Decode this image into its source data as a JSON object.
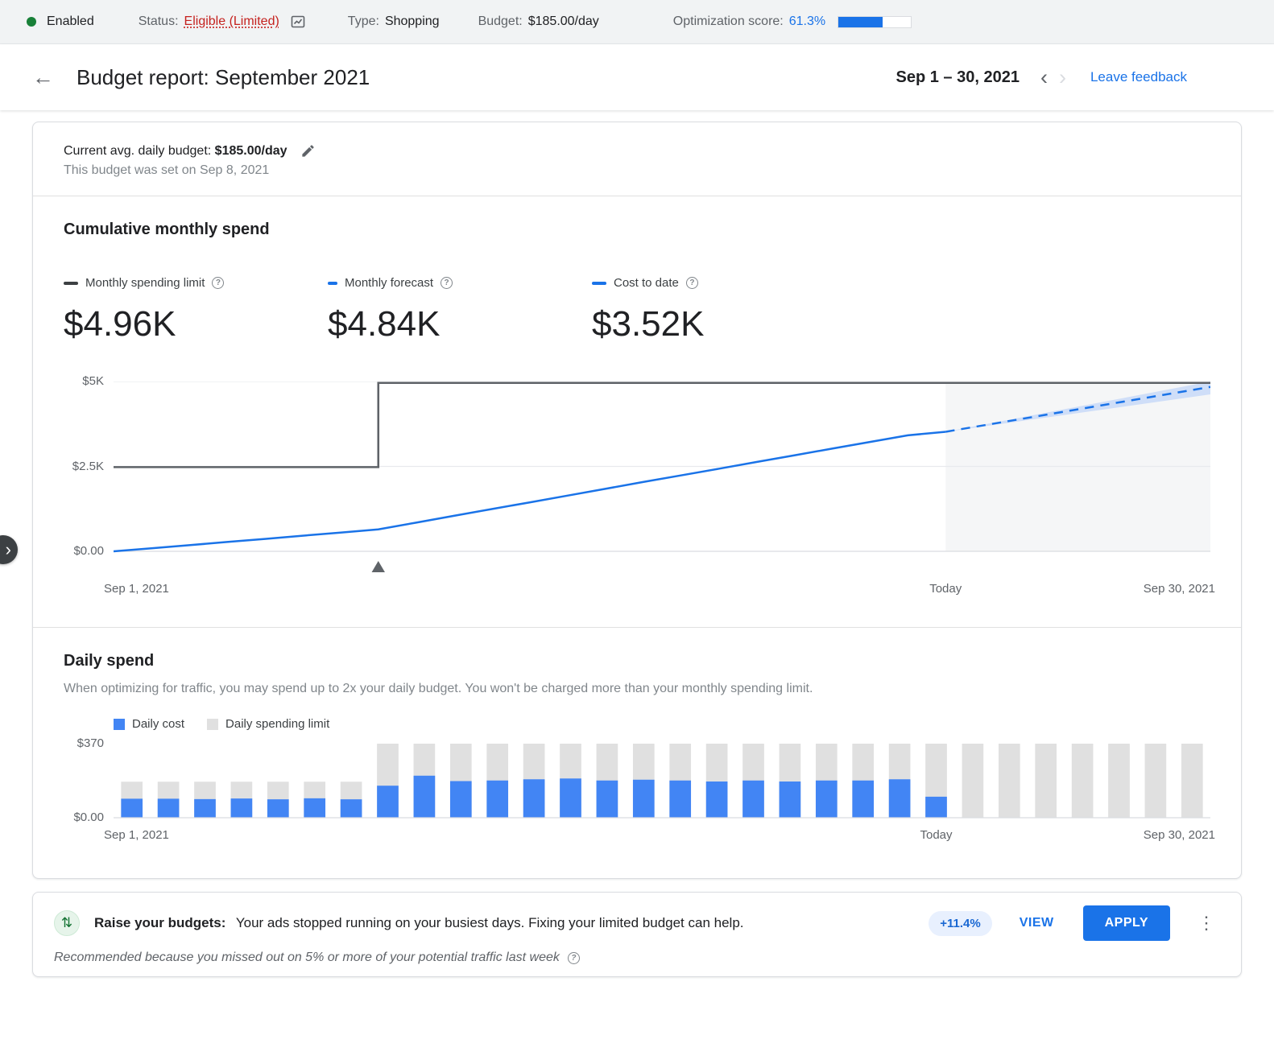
{
  "topbar": {
    "enabled_label": "Enabled",
    "status_label": "Status:",
    "status_value": "Eligible (Limited)",
    "type_label": "Type:",
    "type_value": "Shopping",
    "budget_label": "Budget:",
    "budget_value": "$185.00/day",
    "optimization_label": "Optimization score:",
    "optimization_value": "61.3%",
    "optimization_percent": 61.3
  },
  "header": {
    "title": "Budget report: September 2021",
    "date_range": "Sep 1 – 30, 2021",
    "prev_chevron": "‹",
    "next_chevron": "›",
    "feedback_link": "Leave feedback"
  },
  "budget_summary": {
    "label": "Current avg. daily budget:",
    "value": "$185.00/day",
    "note": "This budget was set on Sep 8, 2021"
  },
  "cumulative_section": {
    "title": "Cumulative monthly spend",
    "stats": [
      {
        "label": "Monthly spending limit",
        "value": "$4.96K",
        "color": "#3c4043"
      },
      {
        "label": "Monthly forecast",
        "value": "$4.84K",
        "color": "#1a73e8"
      },
      {
        "label": "Cost to date",
        "value": "$3.52K",
        "color": "#1a73e8"
      }
    ]
  },
  "daily_section": {
    "title": "Daily spend",
    "subtitle": "When optimizing for traffic, you may spend up to 2x your daily budget. You won't be charged more than your monthly spending limit.",
    "legend": [
      {
        "label": "Daily cost",
        "color": "#4285f4"
      },
      {
        "label": "Daily spending limit",
        "color": "#e0e0e0"
      }
    ]
  },
  "recommendation": {
    "title": "Raise your budgets:",
    "description": "Your ads stopped running on your busiest days. Fixing your limited budget can help.",
    "badge": "+11.4%",
    "view_label": "VIEW",
    "apply_label": "APPLY",
    "footnote": "Recommended because you missed out on 5% or more of your potential traffic last week"
  },
  "chart_data": [
    {
      "type": "line",
      "title": "Cumulative monthly spend",
      "x_unit": "day of September 2021",
      "xlim": [
        1,
        30
      ],
      "ylim": [
        0,
        5000
      ],
      "today_day": 23,
      "budget_change_day": 8,
      "yticks": [
        {
          "value": 5000,
          "label": "$5K"
        },
        {
          "value": 2500,
          "label": "$2.5K"
        },
        {
          "value": 0,
          "label": "$0.00"
        }
      ],
      "xticks": [
        {
          "day": 1,
          "label": "Sep 1, 2021"
        },
        {
          "day": 23,
          "label": "Today"
        },
        {
          "day": 30,
          "label": "Sep 30, 2021"
        }
      ],
      "series": [
        {
          "name": "Monthly spending limit",
          "style": "step",
          "color": "#5f6368",
          "points": [
            [
              1,
              2480
            ],
            [
              8,
              2480
            ],
            [
              8,
              4960
            ],
            [
              30,
              4960
            ]
          ]
        },
        {
          "name": "Cost to date",
          "style": "solid",
          "color": "#1a73e8",
          "points": [
            [
              1,
              0
            ],
            [
              2,
              90
            ],
            [
              3,
              180
            ],
            [
              4,
              275
            ],
            [
              5,
              365
            ],
            [
              6,
              460
            ],
            [
              7,
              550
            ],
            [
              8,
              645
            ],
            [
              9,
              845
            ],
            [
              10,
              1045
            ],
            [
              11,
              1245
            ],
            [
              12,
              1440
            ],
            [
              13,
              1640
            ],
            [
              14,
              1840
            ],
            [
              15,
              2040
            ],
            [
              16,
              2235
            ],
            [
              17,
              2430
            ],
            [
              18,
              2630
            ],
            [
              19,
              2825
            ],
            [
              20,
              3025
            ],
            [
              21,
              3220
            ],
            [
              22,
              3415
            ],
            [
              23,
              3520
            ]
          ]
        },
        {
          "name": "Monthly forecast",
          "style": "dashed",
          "color": "#1a73e8",
          "points": [
            [
              23,
              3520
            ],
            [
              30,
              4840
            ]
          ]
        },
        {
          "name": "Forecast range",
          "style": "band",
          "color": "#aecbfa",
          "upper": [
            [
              23,
              3520
            ],
            [
              30,
              5000
            ]
          ],
          "lower": [
            [
              23,
              3520
            ],
            [
              30,
              4620
            ]
          ]
        }
      ]
    },
    {
      "type": "bar",
      "title": "Daily spend",
      "n_days": 30,
      "ylim": [
        0,
        370
      ],
      "today_day": 23,
      "bar_colors": {
        "cost": "#4285f4",
        "limit": "#e0e0e0"
      },
      "yticks": [
        {
          "value": 370,
          "label": "$370"
        },
        {
          "value": 0,
          "label": "$0.00"
        }
      ],
      "xticks": [
        {
          "day": 1,
          "label": "Sep 1, 2021"
        },
        {
          "day": 23,
          "label": "Today"
        },
        {
          "day": 30,
          "label": "Sep 30, 2021"
        }
      ],
      "daily_cost": [
        95,
        95,
        93,
        96,
        92,
        97,
        92,
        160,
        210,
        183,
        186,
        192,
        196,
        186,
        190,
        186,
        181,
        186,
        181,
        186,
        186,
        192,
        105,
        0,
        0,
        0,
        0,
        0,
        0,
        0
      ],
      "daily_limit": [
        180,
        180,
        180,
        180,
        180,
        180,
        180,
        370,
        370,
        370,
        370,
        370,
        370,
        370,
        370,
        370,
        370,
        370,
        370,
        370,
        370,
        370,
        370,
        370,
        370,
        370,
        370,
        370,
        370,
        370
      ]
    }
  ]
}
